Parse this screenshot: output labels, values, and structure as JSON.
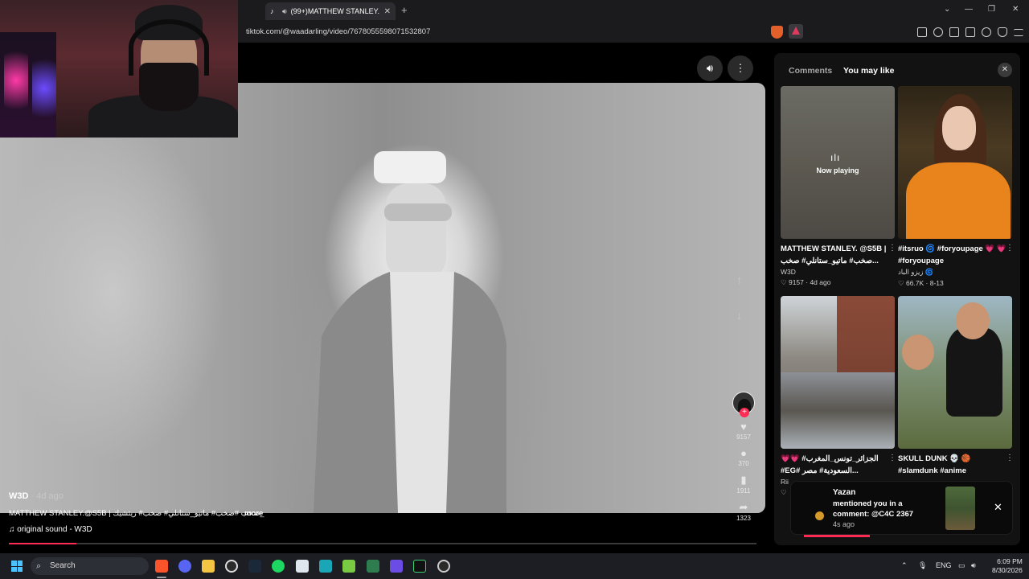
{
  "browser": {
    "tab_title": "(99+)MATTHEW STANLEY. @",
    "url": "tiktok.com/@waadarling/video/7678055598071532807"
  },
  "video": {
    "username": "W3D",
    "time_ago": " · 4d ago",
    "description": "MATTHEW STANLEY.@S5B | صخب #صخب# ماتيو_ستانلي# صخب# ريتشيك_",
    "more_label": "more",
    "sound": "original sound - W3D",
    "likes": "9157",
    "comments": "370",
    "saves": "1911",
    "shares": "1323",
    "progress_fraction": 0.09
  },
  "panel": {
    "tab_comments": "Comments",
    "tab_you_may_like": "You may like",
    "now_playing": "Now playing",
    "cards": [
      {
        "title": "MATTHEW STANLEY. @S5B | صخب# ماتيو_ستانلي# صخب...",
        "user": "W3D",
        "stats": "♡ 9157 · 4d ago"
      },
      {
        "title": "#itsruo 🌀 #foryoupage 💗 💗 #foryoupage",
        "user": "زيزو الباد 🌀",
        "stats": "♡ 66.7K · 8-13"
      },
      {
        "title": "💗💗 #الجزائر_تونس_المغرب #EG# السعودية# مصر...",
        "user": "Rii",
        "stats": "♡"
      },
      {
        "title": "SKULL DUNK 💀 🏀 #slamdunk #anime",
        "user": "",
        "stats": ""
      }
    ]
  },
  "notification": {
    "name": "Yazan",
    "message": "mentioned you in a comment: @C4C 2367",
    "time": "4s ago"
  },
  "taskbar": {
    "search_label": "Search",
    "language": "ENG",
    "time": "6:09 PM",
    "date": "8/30/2026"
  },
  "colors": {
    "accent": "#fe2c55",
    "panel_bg": "#121212",
    "taskbar_bg": "#1c1e24"
  }
}
